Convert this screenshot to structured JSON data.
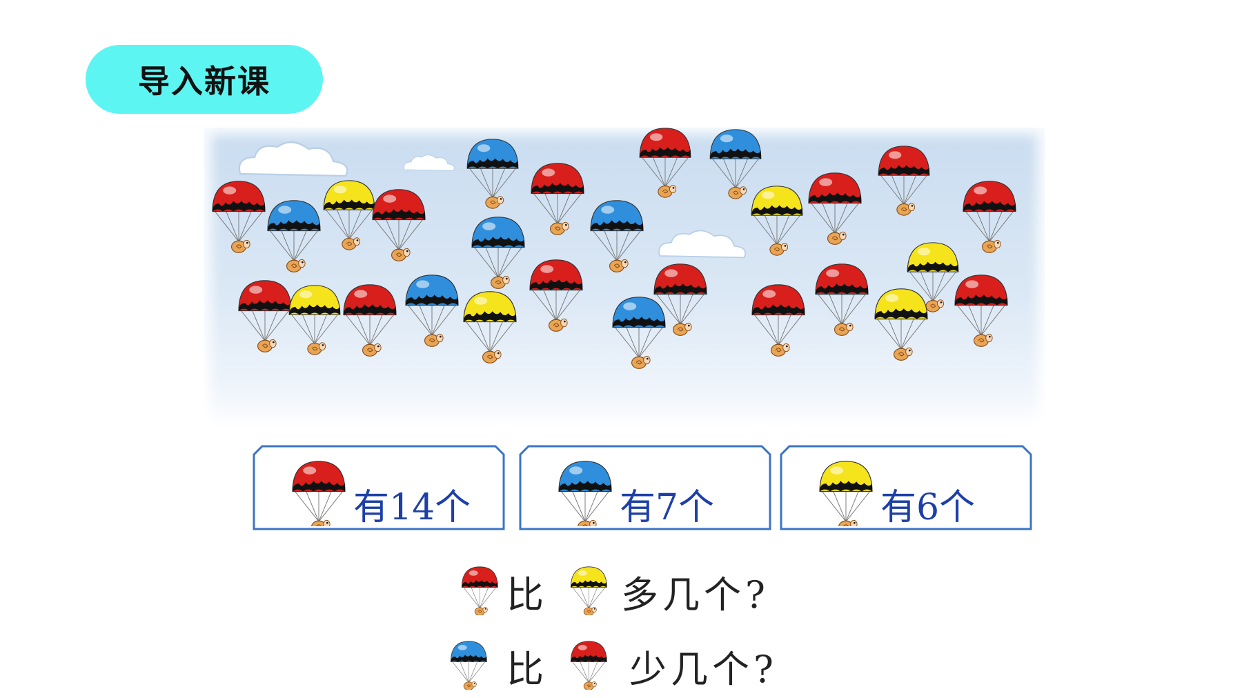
{
  "header": {
    "title": "导入新课"
  },
  "colors": {
    "red": "#d81f1c",
    "blue": "#2f8fdc",
    "yellow": "#f5e31c",
    "tag": "#5cf5f2",
    "count_text": "#1d3fa8"
  },
  "counts": [
    {
      "color": "red",
      "label": "有14个"
    },
    {
      "color": "blue",
      "label": "有7个"
    },
    {
      "color": "yellow",
      "label": "有6个"
    }
  ],
  "questions": [
    {
      "first": "red",
      "word": "比",
      "second": "yellow",
      "text": "多几个?"
    },
    {
      "first": "blue",
      "word": "比",
      "second": "red",
      "text": "少几个?"
    }
  ]
}
